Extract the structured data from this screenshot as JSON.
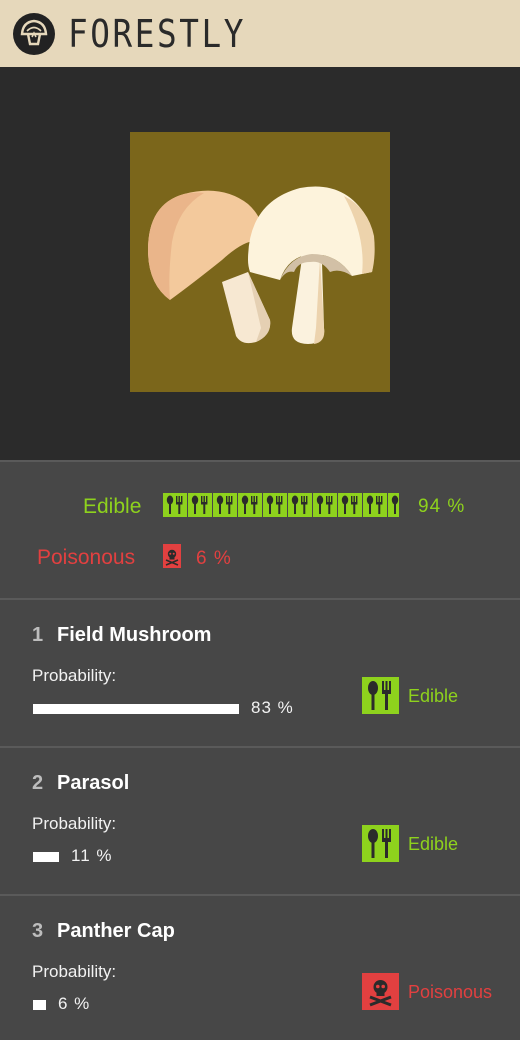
{
  "header": {
    "brand": "FORESTLY",
    "logo_icon": "mushroom-logo-icon"
  },
  "hero": {
    "image": "mushroom-photo",
    "image_bg": "#7b661b"
  },
  "summary": {
    "edible": {
      "label": "Edible",
      "percent": 94,
      "percent_text": "94 %",
      "color": "#8ed21d",
      "icon": "cutlery-icon"
    },
    "poisonous": {
      "label": "Poisonous",
      "percent": 6,
      "percent_text": "6 %",
      "color": "#e24040",
      "icon": "skull-icon"
    }
  },
  "results": [
    {
      "rank": "1",
      "name": "Field Mushroom",
      "probability_label": "Probability:",
      "probability": 83,
      "probability_text": "83 %",
      "class": "Edible",
      "icon": "cutlery-icon",
      "color": "#8ed21d"
    },
    {
      "rank": "2",
      "name": "Parasol",
      "probability_label": "Probability:",
      "probability": 11,
      "probability_text": "11 %",
      "class": "Edible",
      "icon": "cutlery-icon",
      "color": "#8ed21d"
    },
    {
      "rank": "3",
      "name": "Panther Cap",
      "probability_label": "Probability:",
      "probability": 6,
      "probability_text": "6 %",
      "class": "Poisonous",
      "icon": "skull-icon",
      "color": "#e24040"
    }
  ]
}
